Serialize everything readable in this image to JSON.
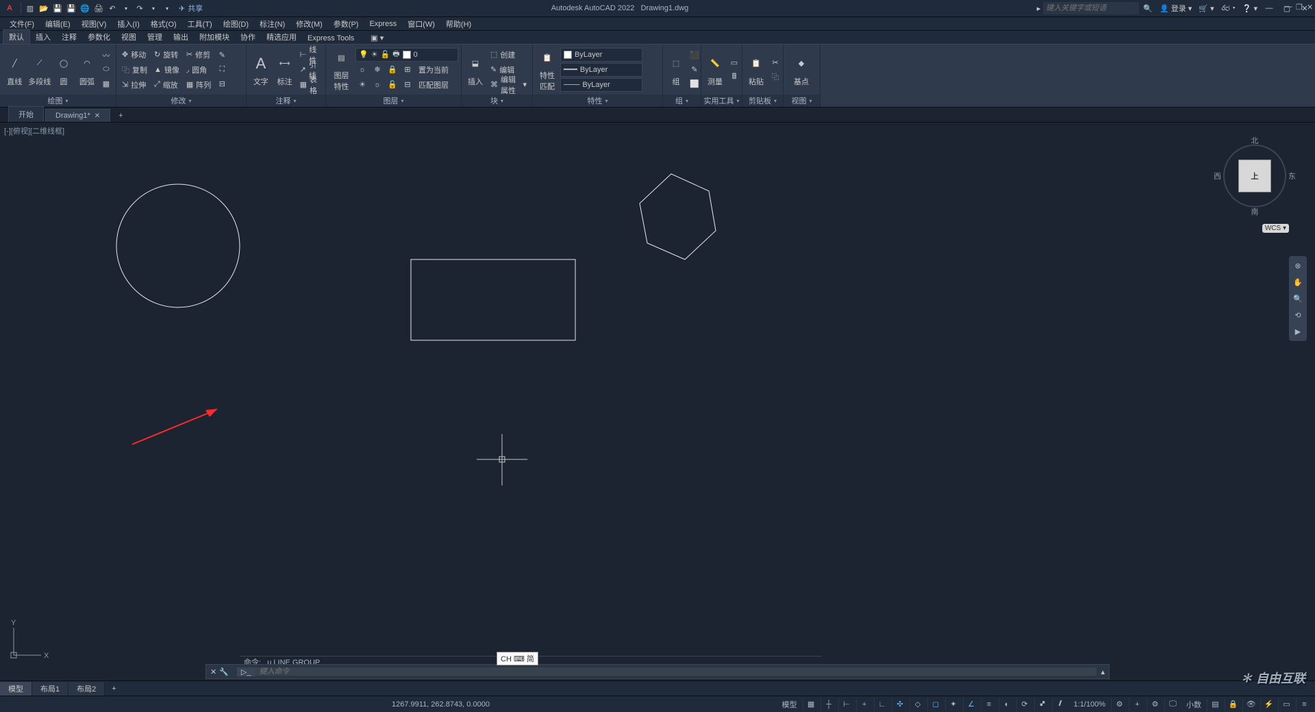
{
  "title": {
    "app": "Autodesk AutoCAD 2022",
    "file": "Drawing1.dwg"
  },
  "search": {
    "placeholder": "键入关键字或短语"
  },
  "account": {
    "login": "登录"
  },
  "share": "共享",
  "menubar": [
    "文件(F)",
    "编辑(E)",
    "视图(V)",
    "插入(I)",
    "格式(O)",
    "工具(T)",
    "绘图(D)",
    "标注(N)",
    "修改(M)",
    "参数(P)",
    "Express",
    "窗口(W)",
    "帮助(H)"
  ],
  "ribbontabs": [
    "默认",
    "插入",
    "注释",
    "参数化",
    "视图",
    "管理",
    "输出",
    "附加模块",
    "协作",
    "精选应用",
    "Express Tools"
  ],
  "panels": {
    "draw": {
      "title": "绘图",
      "line": "直线",
      "polyline": "多段线",
      "circle": "圆",
      "arc": "圆弧"
    },
    "modify": {
      "title": "修改",
      "move": "移动",
      "rotate": "旋转",
      "trim": "修剪",
      "copy": "复制",
      "mirror": "镜像",
      "fillet": "圆角",
      "stretch": "拉伸",
      "scale": "缩放",
      "array": "阵列"
    },
    "annot": {
      "title": "注释",
      "text": "文字",
      "dim": "标注",
      "linetype": "线性",
      "leader": "引线",
      "table": "表格"
    },
    "layer": {
      "title": "图层",
      "props": "图层\n特性",
      "layer0": "0",
      "setcurrent": "置为当前",
      "matchlayer": "匹配图层"
    },
    "block": {
      "title": "块",
      "insert": "插入",
      "create": "创建",
      "edit": "编辑",
      "editattr": "编辑属性"
    },
    "props": {
      "title": "特性",
      "match": "特性\n匹配",
      "bylayer": "ByLayer"
    },
    "group": {
      "title": "组",
      "group": "组"
    },
    "util": {
      "title": "实用工具",
      "measure": "测量"
    },
    "clip": {
      "title": "剪贴板",
      "paste": "粘贴"
    },
    "view": {
      "title": "视图",
      "base": "基点"
    }
  },
  "doctabs": {
    "start": "开始",
    "drawing": "Drawing1*"
  },
  "viewlabel": "[-][俯视][二维线框]",
  "viewcube": {
    "n": "北",
    "s": "南",
    "e": "东",
    "w": "西",
    "top": "上",
    "wcs": "WCS"
  },
  "cmd": {
    "history": "命令: _u LINE GROUP",
    "placeholder": "键入命令"
  },
  "ime": "CH ⌨ 简",
  "layouts": {
    "model": "模型",
    "l1": "布局1",
    "l2": "布局2"
  },
  "status": {
    "coords": "1267.9911, 262.8743, 0.0000",
    "model": "模型",
    "scale": "1:1/100%",
    "decimal": "小数"
  },
  "watermark": "自由互联"
}
